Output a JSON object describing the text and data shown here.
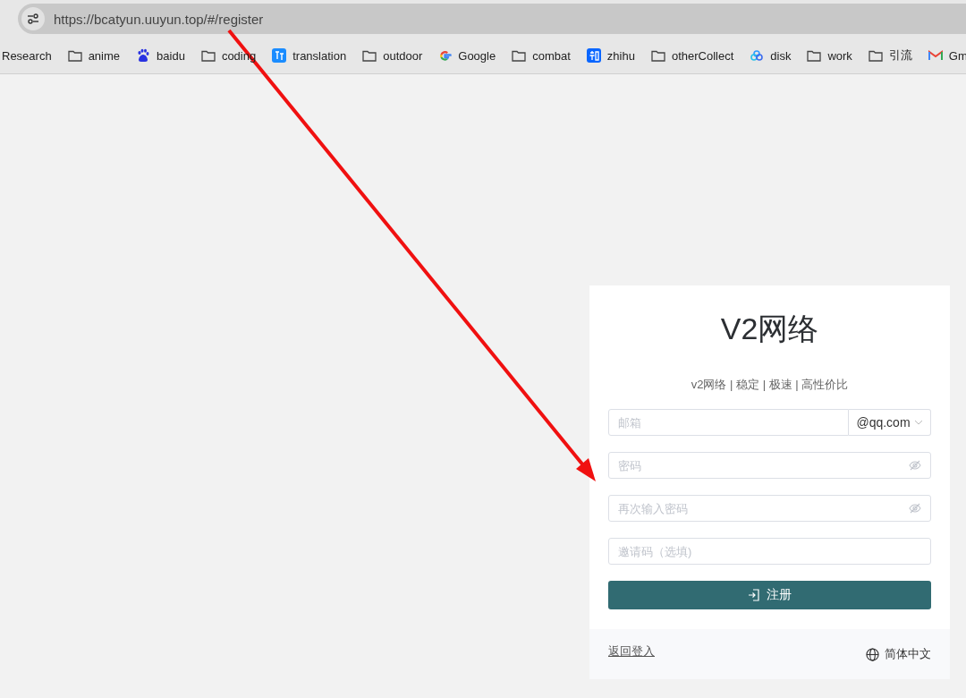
{
  "browser": {
    "url": "https://bcatyun.uuyun.top/#/register"
  },
  "bookmarks": [
    {
      "label": "Research",
      "kind": "none"
    },
    {
      "label": "anime",
      "kind": "folder"
    },
    {
      "label": "baidu",
      "kind": "paw"
    },
    {
      "label": "coding",
      "kind": "folder"
    },
    {
      "label": "translation",
      "kind": "translate"
    },
    {
      "label": "outdoor",
      "kind": "folder"
    },
    {
      "label": "Google",
      "kind": "google"
    },
    {
      "label": "combat",
      "kind": "folder"
    },
    {
      "label": "zhihu",
      "kind": "zhihu"
    },
    {
      "label": "otherCollect",
      "kind": "folder"
    },
    {
      "label": "disk",
      "kind": "cloud"
    },
    {
      "label": "work",
      "kind": "folder"
    },
    {
      "label": "引流",
      "kind": "folder"
    },
    {
      "label": "Gm",
      "kind": "mail"
    }
  ],
  "card": {
    "title": "V2网络",
    "subtitle": "v2网络 | 稳定 | 极速 | 高性价比",
    "fields": [
      {
        "kind": "email",
        "placeholder": "邮箱",
        "suffix": "@qq.com"
      },
      {
        "kind": "password",
        "placeholder": "密码"
      },
      {
        "kind": "password",
        "placeholder": "再次输入密码"
      },
      {
        "kind": "text",
        "placeholder": "邀请码（选填)"
      }
    ],
    "submit": "注册",
    "back_link": "返回登入",
    "language": "简体中文"
  }
}
